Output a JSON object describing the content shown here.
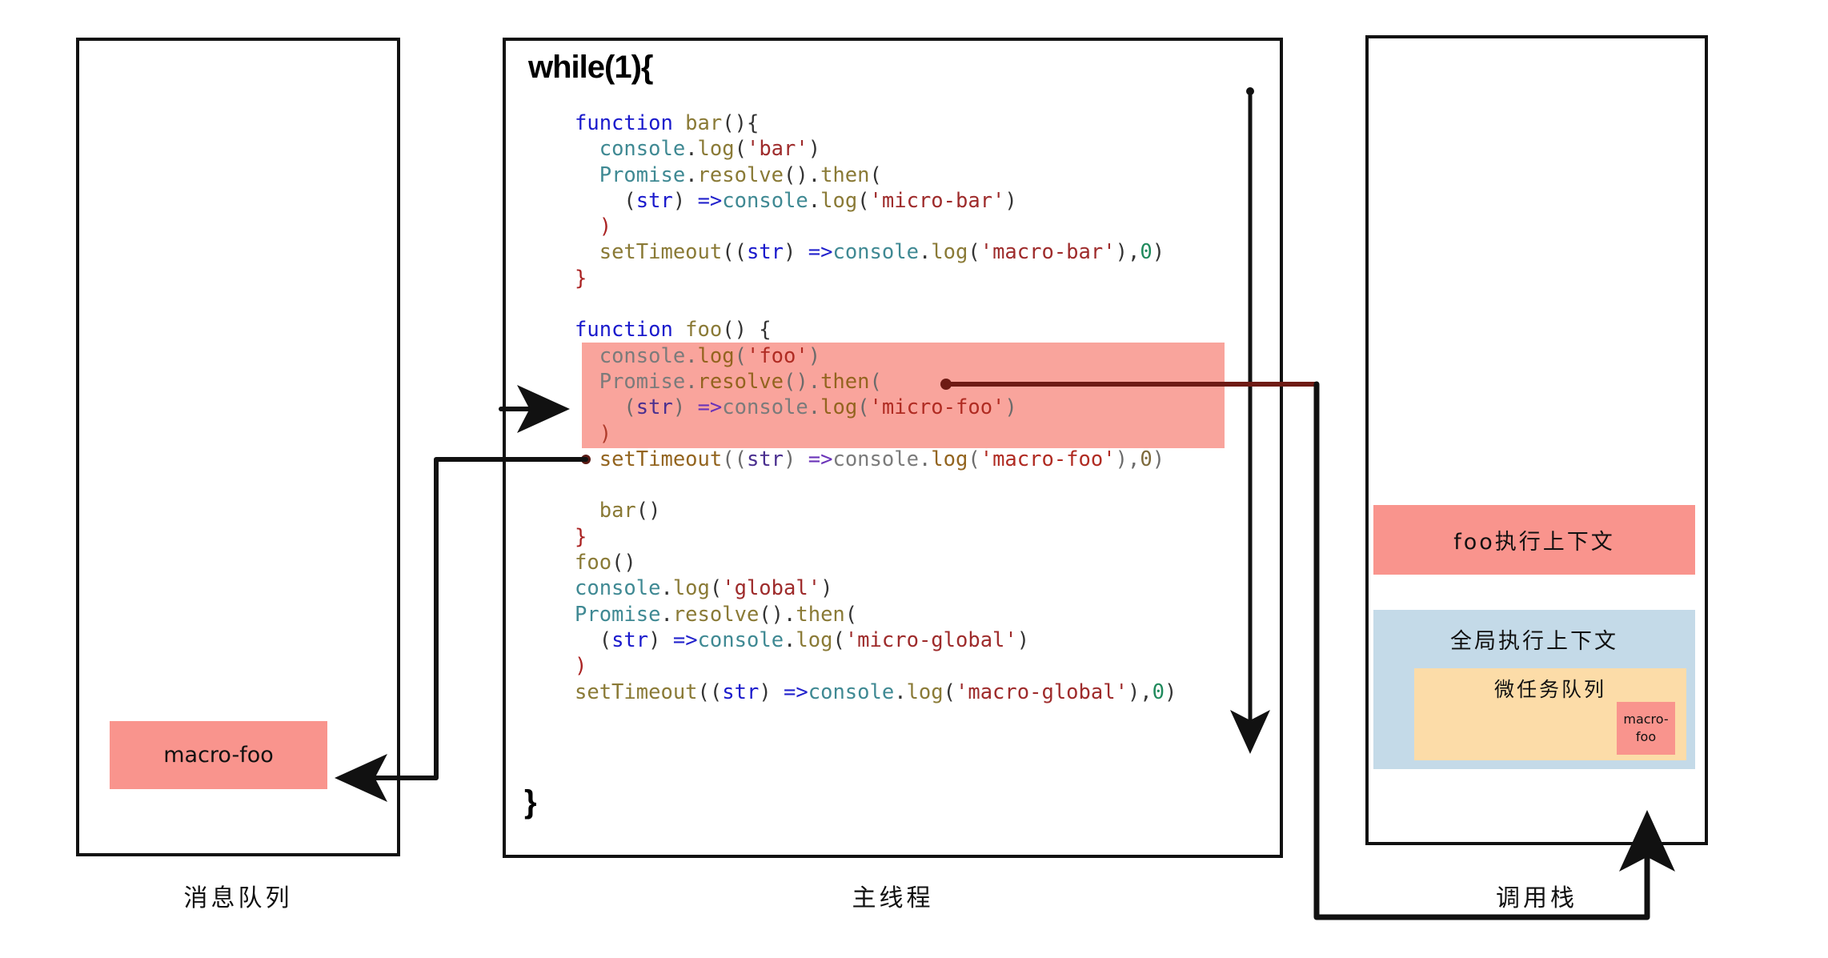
{
  "panels": {
    "message_queue": {
      "caption": "消息队列"
    },
    "main_thread": {
      "caption": "主线程",
      "loop_head": "while(1){",
      "loop_tail": "}"
    },
    "call_stack": {
      "caption": "调用栈"
    }
  },
  "message_queue_tasks": [
    {
      "label": "macro-foo",
      "color": "#F9948D"
    }
  ],
  "call_stack_frames": [
    {
      "label": "foo执行上下文",
      "color": "#F9948D"
    },
    {
      "label": "全局执行上下文",
      "color": "#C4DAE8"
    }
  ],
  "microtask_queue": {
    "label": "微任务队列",
    "color": "#FCDCA8",
    "tasks": [
      {
        "line1": "macro-",
        "line2": "foo",
        "color": "#F9948D"
      }
    ]
  },
  "colors": {
    "salmon": "#F9948D",
    "salmon_highlight": "#F9A49C",
    "blue": "#C4DAE8",
    "orange": "#FCDCA8",
    "ink": "#111111",
    "wire_red": "#6E1B15"
  },
  "code": {
    "highlight_label": "foo-body-highlight",
    "lines": [
      {
        "id": 0,
        "hl": false,
        "tokens": [
          {
            "t": "function ",
            "c": "kw"
          },
          {
            "t": "bar",
            "c": "fn"
          },
          {
            "t": "(){",
            "c": "pn"
          }
        ],
        "indent": 0
      },
      {
        "id": 1,
        "hl": false,
        "tokens": [
          {
            "t": "console",
            "c": "obj"
          },
          {
            "t": ".",
            "c": "pn"
          },
          {
            "t": "log",
            "c": "fn"
          },
          {
            "t": "(",
            "c": "pn"
          },
          {
            "t": "'bar'",
            "c": "str"
          },
          {
            "t": ")",
            "c": "pn"
          }
        ],
        "indent": 1
      },
      {
        "id": 2,
        "hl": false,
        "tokens": [
          {
            "t": "Promise",
            "c": "obj"
          },
          {
            "t": ".",
            "c": "pn"
          },
          {
            "t": "resolve",
            "c": "fn"
          },
          {
            "t": "().",
            "c": "pn"
          },
          {
            "t": "then",
            "c": "fn"
          },
          {
            "t": "(",
            "c": "pn"
          }
        ],
        "indent": 1
      },
      {
        "id": 3,
        "hl": false,
        "tokens": [
          {
            "t": "(",
            "c": "pn"
          },
          {
            "t": "str",
            "c": "arg"
          },
          {
            "t": ") ",
            "c": "pn"
          },
          {
            "t": "=>",
            "c": "arw"
          },
          {
            "t": "console",
            "c": "obj"
          },
          {
            "t": ".",
            "c": "pn"
          },
          {
            "t": "log",
            "c": "fn"
          },
          {
            "t": "(",
            "c": "pn"
          },
          {
            "t": "'micro-bar'",
            "c": "str"
          },
          {
            "t": ")",
            "c": "pn"
          }
        ],
        "indent": 2
      },
      {
        "id": 4,
        "hl": false,
        "tokens": [
          {
            "t": ")",
            "c": "brc"
          }
        ],
        "indent": 1
      },
      {
        "id": 5,
        "hl": false,
        "tokens": [
          {
            "t": "setTimeout",
            "c": "fn"
          },
          {
            "t": "((",
            "c": "pn"
          },
          {
            "t": "str",
            "c": "arg"
          },
          {
            "t": ") ",
            "c": "pn"
          },
          {
            "t": "=>",
            "c": "arw"
          },
          {
            "t": "console",
            "c": "obj"
          },
          {
            "t": ".",
            "c": "pn"
          },
          {
            "t": "log",
            "c": "fn"
          },
          {
            "t": "(",
            "c": "pn"
          },
          {
            "t": "'macro-bar'",
            "c": "str"
          },
          {
            "t": "),",
            "c": "pn"
          },
          {
            "t": "0",
            "c": "num"
          },
          {
            "t": ")",
            "c": "pn"
          }
        ],
        "indent": 1
      },
      {
        "id": 6,
        "hl": false,
        "tokens": [
          {
            "t": "}",
            "c": "brc"
          }
        ],
        "indent": 0
      },
      {
        "id": 7,
        "hl": false,
        "tokens": [
          {
            "t": " ",
            "c": "pn"
          }
        ],
        "indent": 0
      },
      {
        "id": 8,
        "hl": false,
        "tokens": [
          {
            "t": "function ",
            "c": "kw"
          },
          {
            "t": "foo",
            "c": "fn"
          },
          {
            "t": "() {",
            "c": "pn"
          }
        ],
        "indent": 0
      },
      {
        "id": 9,
        "hl": true,
        "tokens": [
          {
            "t": "console",
            "c": "obj"
          },
          {
            "t": ".",
            "c": "pn"
          },
          {
            "t": "log",
            "c": "fn"
          },
          {
            "t": "(",
            "c": "pn"
          },
          {
            "t": "'foo'",
            "c": "str"
          },
          {
            "t": ")",
            "c": "pn"
          }
        ],
        "indent": 1
      },
      {
        "id": 10,
        "hl": true,
        "tokens": [
          {
            "t": "Promise",
            "c": "obj"
          },
          {
            "t": ".",
            "c": "pn"
          },
          {
            "t": "resolve",
            "c": "fn"
          },
          {
            "t": "().",
            "c": "pn"
          },
          {
            "t": "then",
            "c": "fn"
          },
          {
            "t": "(",
            "c": "pn"
          }
        ],
        "indent": 1
      },
      {
        "id": 11,
        "hl": true,
        "tokens": [
          {
            "t": "(",
            "c": "pn"
          },
          {
            "t": "str",
            "c": "arg"
          },
          {
            "t": ") ",
            "c": "pn"
          },
          {
            "t": "=>",
            "c": "arw"
          },
          {
            "t": "console",
            "c": "obj"
          },
          {
            "t": ".",
            "c": "pn"
          },
          {
            "t": "log",
            "c": "fn"
          },
          {
            "t": "(",
            "c": "pn"
          },
          {
            "t": "'micro-foo'",
            "c": "str"
          },
          {
            "t": ")",
            "c": "pn"
          }
        ],
        "indent": 2
      },
      {
        "id": 12,
        "hl": true,
        "tokens": [
          {
            "t": ")",
            "c": "brc"
          }
        ],
        "indent": 1
      },
      {
        "id": 13,
        "hl": true,
        "tokens": [
          {
            "t": "setTimeout",
            "c": "fn"
          },
          {
            "t": "((",
            "c": "pn"
          },
          {
            "t": "str",
            "c": "arg"
          },
          {
            "t": ") ",
            "c": "pn"
          },
          {
            "t": "=>",
            "c": "arw"
          },
          {
            "t": "console",
            "c": "obj"
          },
          {
            "t": ".",
            "c": "pn"
          },
          {
            "t": "log",
            "c": "fn"
          },
          {
            "t": "(",
            "c": "pn"
          },
          {
            "t": "'macro-foo'",
            "c": "str"
          },
          {
            "t": "),",
            "c": "pn"
          },
          {
            "t": "0",
            "c": "num"
          },
          {
            "t": ")",
            "c": "pn"
          }
        ],
        "indent": 1
      },
      {
        "id": 14,
        "hl": false,
        "tokens": [
          {
            "t": " ",
            "c": "pn"
          }
        ],
        "indent": 0
      },
      {
        "id": 15,
        "hl": false,
        "tokens": [
          {
            "t": "bar",
            "c": "fn"
          },
          {
            "t": "()",
            "c": "pn"
          }
        ],
        "indent": 1
      },
      {
        "id": 16,
        "hl": false,
        "tokens": [
          {
            "t": "}",
            "c": "brc"
          }
        ],
        "indent": 0
      },
      {
        "id": 17,
        "hl": false,
        "tokens": [
          {
            "t": "foo",
            "c": "fn"
          },
          {
            "t": "()",
            "c": "pn"
          }
        ],
        "indent": 0
      },
      {
        "id": 18,
        "hl": false,
        "tokens": [
          {
            "t": "console",
            "c": "obj"
          },
          {
            "t": ".",
            "c": "pn"
          },
          {
            "t": "log",
            "c": "fn"
          },
          {
            "t": "(",
            "c": "pn"
          },
          {
            "t": "'global'",
            "c": "str"
          },
          {
            "t": ")",
            "c": "pn"
          }
        ],
        "indent": 0
      },
      {
        "id": 19,
        "hl": false,
        "tokens": [
          {
            "t": "Promise",
            "c": "obj"
          },
          {
            "t": ".",
            "c": "pn"
          },
          {
            "t": "resolve",
            "c": "fn"
          },
          {
            "t": "().",
            "c": "pn"
          },
          {
            "t": "then",
            "c": "fn"
          },
          {
            "t": "(",
            "c": "pn"
          }
        ],
        "indent": 0
      },
      {
        "id": 20,
        "hl": false,
        "tokens": [
          {
            "t": "(",
            "c": "pn"
          },
          {
            "t": "str",
            "c": "arg"
          },
          {
            "t": ") ",
            "c": "pn"
          },
          {
            "t": "=>",
            "c": "arw"
          },
          {
            "t": "console",
            "c": "obj"
          },
          {
            "t": ".",
            "c": "pn"
          },
          {
            "t": "log",
            "c": "fn"
          },
          {
            "t": "(",
            "c": "pn"
          },
          {
            "t": "'micro-global'",
            "c": "str"
          },
          {
            "t": ")",
            "c": "pn"
          }
        ],
        "indent": 1
      },
      {
        "id": 21,
        "hl": false,
        "tokens": [
          {
            "t": ")",
            "c": "brc"
          }
        ],
        "indent": 0
      },
      {
        "id": 22,
        "hl": false,
        "tokens": [
          {
            "t": "setTimeout",
            "c": "fn"
          },
          {
            "t": "((",
            "c": "pn"
          },
          {
            "t": "str",
            "c": "arg"
          },
          {
            "t": ") ",
            "c": "pn"
          },
          {
            "t": "=>",
            "c": "arw"
          },
          {
            "t": "console",
            "c": "obj"
          },
          {
            "t": ".",
            "c": "pn"
          },
          {
            "t": "log",
            "c": "fn"
          },
          {
            "t": "(",
            "c": "pn"
          },
          {
            "t": "'macro-global'",
            "c": "str"
          },
          {
            "t": "),",
            "c": "pn"
          },
          {
            "t": "0",
            "c": "num"
          },
          {
            "t": ")",
            "c": "pn"
          }
        ],
        "indent": 0
      }
    ]
  },
  "connectors": [
    {
      "name": "execution-flow-down-arrow",
      "desc": "vertical arrow inside main thread pointing down"
    },
    {
      "name": "enter-foo-body-arrow",
      "desc": "arrow pointing right into highlighted foo body"
    },
    {
      "name": "settimeout-to-message-queue",
      "desc": "line from setTimeout('macro-foo') left & down into macro-foo task box"
    },
    {
      "name": "promise-then-to-microtask-queue",
      "desc": "line from Promise.resolve().then( right, down, around to microtask queue"
    }
  ]
}
